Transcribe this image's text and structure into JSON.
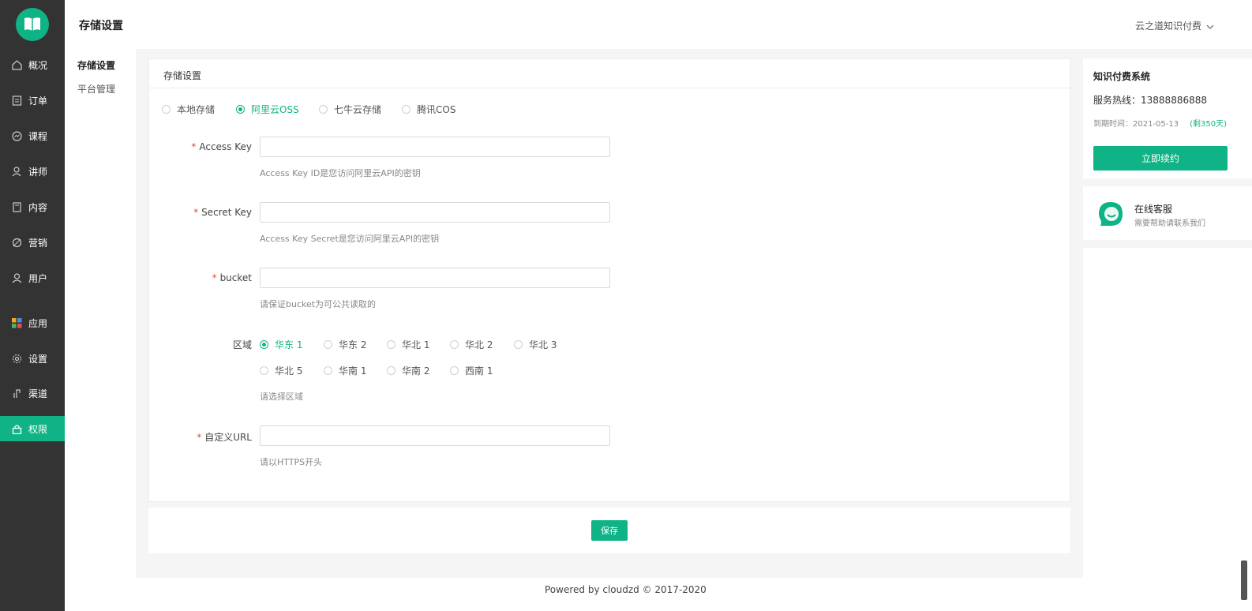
{
  "app": {
    "page_title": "存储设置",
    "user_menu": "云之道知识付费"
  },
  "sidebar": {
    "items": [
      {
        "label": "概况",
        "icon": "home-icon"
      },
      {
        "label": "订单",
        "icon": "order-icon"
      },
      {
        "label": "课程",
        "icon": "course-icon"
      },
      {
        "label": "讲师",
        "icon": "teacher-icon"
      },
      {
        "label": "内容",
        "icon": "content-icon"
      },
      {
        "label": "营销",
        "icon": "marketing-icon"
      },
      {
        "label": "用户",
        "icon": "user-icon"
      },
      {
        "label": "应用",
        "icon": "apps-icon"
      },
      {
        "label": "设置",
        "icon": "gear-icon"
      },
      {
        "label": "渠道",
        "icon": "channel-icon"
      },
      {
        "label": "权限",
        "icon": "lock-icon"
      }
    ],
    "active": "权限"
  },
  "submenu": {
    "items": [
      "存储设置",
      "平台管理"
    ],
    "active": "存储设置"
  },
  "card": {
    "title": "存储设置",
    "storage_options": [
      "本地存储",
      "阿里云OSS",
      "七牛云存储",
      "腾讯COS"
    ],
    "storage_selected": "阿里云OSS",
    "fields": {
      "access_key": {
        "label": "Access Key",
        "value": "",
        "help": "Access Key ID是您访问阿里云API的密钥"
      },
      "secret_key": {
        "label": "Secret Key",
        "value": "",
        "help": "Access Key Secret是您访问阿里云API的密钥"
      },
      "bucket": {
        "label": "bucket",
        "value": "",
        "help": "请保证bucket为可公共读取的"
      },
      "region": {
        "label": "区域",
        "options": [
          "华东 1",
          "华东 2",
          "华北 1",
          "华北 2",
          "华北 3",
          "华北 5",
          "华南 1",
          "华南 2",
          "西南 1"
        ],
        "selected": "华东 1",
        "help": "请选择区域"
      },
      "custom_url": {
        "label": "自定义URL",
        "value": "",
        "help": "请以HTTPS开头"
      }
    },
    "required_mark": "*"
  },
  "actions": {
    "save": "保存"
  },
  "footer": {
    "text": "Powered by cloudzd © 2017-2020"
  },
  "right_panel": {
    "title": "知识付费系统",
    "hotline_label": "服务热线：",
    "hotline": "13888886888",
    "expire_label": "到期时间：",
    "expire_date": "2021-05-13",
    "remaining": "(剩350天)",
    "renew_button": "立即续约",
    "service_title": "在线客服",
    "service_sub": "需要帮助请联系我们"
  },
  "colors": {
    "accent": "#10b385",
    "sidebar_bg": "#333333",
    "required": "#e2483d"
  }
}
